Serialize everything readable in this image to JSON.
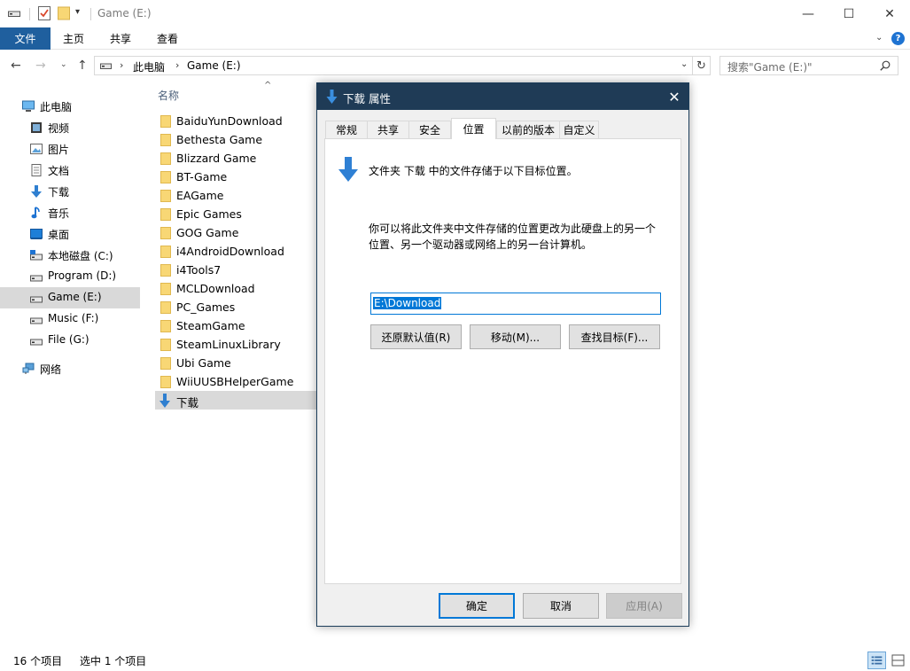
{
  "titlebar": {
    "title": "Game (E:)",
    "qat_dropdown": "▾",
    "min": "—",
    "max": "☐",
    "close": "✕"
  },
  "ribbon": {
    "tabs": [
      "文件",
      "主页",
      "共享",
      "查看"
    ],
    "chevron": "⌄",
    "help": "?"
  },
  "navbar": {
    "back": "←",
    "forward": "→",
    "recent": "⌄",
    "up": "↑",
    "address": {
      "separator": "›",
      "parts": [
        "此电脑",
        "Game (E:)"
      ],
      "dropdown": "⌄"
    },
    "refresh": "↻",
    "search_placeholder": "搜索\"Game (E:)\""
  },
  "sidebar": {
    "items": [
      {
        "label": "此电脑",
        "icon": "pc-icon"
      },
      {
        "label": "视频",
        "icon": "video-icon"
      },
      {
        "label": "图片",
        "icon": "pictures-icon"
      },
      {
        "label": "文档",
        "icon": "documents-icon"
      },
      {
        "label": "下载",
        "icon": "download-icon"
      },
      {
        "label": "音乐",
        "icon": "music-icon"
      },
      {
        "label": "桌面",
        "icon": "desktop-icon"
      },
      {
        "label": "本地磁盘 (C:)",
        "icon": "drive-icon"
      },
      {
        "label": "Program (D:)",
        "icon": "drive-icon"
      },
      {
        "label": "Game (E:)",
        "icon": "drive-icon",
        "selected": true
      },
      {
        "label": "Music (F:)",
        "icon": "drive-icon"
      },
      {
        "label": "File (G:)",
        "icon": "drive-icon"
      },
      {
        "label": "网络",
        "icon": "network-icon"
      }
    ]
  },
  "filelist": {
    "column_name": "名称",
    "sort_indicator": "^",
    "items": [
      "BaiduYunDownload",
      "Bethesta Game",
      "Blizzard Game",
      "BT-Game",
      "EAGame",
      "Epic Games",
      "GOG Game",
      "i4AndroidDownload",
      "i4Tools7",
      "MCLDownload",
      "PC_Games",
      "SteamGame",
      "SteamLinuxLibrary",
      "Ubi Game",
      "WiiUUSBHelperGame",
      "下载"
    ]
  },
  "statusbar": {
    "count": "16 个项目",
    "selected": "选中 1 个项目"
  },
  "dialog": {
    "title": "下载 属性",
    "close": "✕",
    "tabs": [
      "常规",
      "共享",
      "安全",
      "位置",
      "以前的版本",
      "自定义"
    ],
    "active_tab": 3,
    "description": "文件夹 下载 中的文件存储于以下目标位置。",
    "help_line1": "你可以将此文件夹中文件存储的位置更改为此硬盘上的另一个",
    "help_line2": "位置、另一个驱动器或网络上的另一台计算机。",
    "path": "E:\\Download",
    "buttons": {
      "restore": "还原默认值(R)",
      "move": "移动(M)...",
      "find": "查找目标(F)...",
      "ok": "确定",
      "cancel": "取消",
      "apply": "应用(A)"
    }
  },
  "colors": {
    "accent": "#0078d7",
    "file_tab": "#1f5f9e",
    "dialog_title": "#1f3b56",
    "folder": "#f8d775",
    "selection": "#d9d9d9"
  }
}
